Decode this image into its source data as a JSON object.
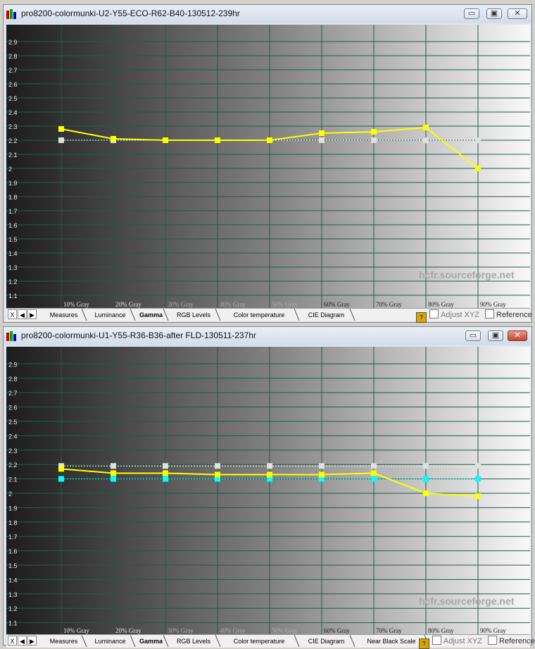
{
  "windows": [
    {
      "title": "pro8200-colormunki-U2-Y55-ECO-R62-B40-130512-239hr",
      "controls": {
        "minimize": "▭",
        "maximize": "▣",
        "close": "✕"
      },
      "tabs": {
        "close": "X",
        "prev": "◀",
        "next": "▶",
        "items": [
          "Measures",
          "Luminance",
          "Gamma",
          "RGB Levels",
          "Color temperature",
          "CIE Diagram"
        ],
        "active": "Gamma",
        "adjust_xyz": "Adjust XYZ",
        "reference": "Reference"
      },
      "chart": {
        "watermark": "hcfr.sourceforge.net",
        "x_labels": [
          "10% Gray",
          "20% Gray",
          "30% Gray",
          "40% Gray",
          "50% Gray",
          "60% Gray",
          "70% Gray",
          "80% Gray",
          "90% Gray"
        ],
        "y_ticks": [
          "2.9",
          "2.8",
          "2.7",
          "2.6",
          "2.5",
          "2.4",
          "2.3",
          "2.2",
          "2.1",
          "2",
          "1.9",
          "1.8",
          "1.7",
          "1.6",
          "1.5",
          "1.4",
          "1.3",
          "1.2",
          "1.1"
        ]
      }
    },
    {
      "title": "pro8200-colormunki-U1-Y55-R36-B36-after FLD-130511-237hr",
      "controls": {
        "minimize": "▭",
        "maximize": "▣",
        "close": "✕"
      },
      "tabs": {
        "close": "X",
        "prev": "◀",
        "next": "▶",
        "items": [
          "Measures",
          "Luminance",
          "Gamma",
          "RGB Levels",
          "Color temperature",
          "CIE Diagram",
          "Near Black Scale"
        ],
        "active": "Gamma",
        "adjust_xyz": "Adjust XYZ",
        "reference": "Reference"
      },
      "chart": {
        "watermark": "hcfr.sourceforge.net",
        "x_labels": [
          "10% Gray",
          "20% Gray",
          "30% Gray",
          "40% Gray",
          "50% Gray",
          "60% Gray",
          "70% Gray",
          "80% Gray",
          "90% Gray"
        ],
        "y_ticks": [
          "2.9",
          "2.8",
          "2.7",
          "2.6",
          "2.5",
          "2.4",
          "2.3",
          "2.2",
          "2.1",
          "2",
          "1.9",
          "1.8",
          "1.7",
          "1.6",
          "1.5",
          "1.4",
          "1.3",
          "1.2",
          "1.1"
        ]
      }
    }
  ],
  "chart_data": [
    {
      "type": "line",
      "x": [
        "10% Gray",
        "20% Gray",
        "30% Gray",
        "40% Gray",
        "50% Gray",
        "60% Gray",
        "70% Gray",
        "80% Gray",
        "90% Gray"
      ],
      "ylim": [
        1.0,
        3.0
      ],
      "grid": true,
      "series": [
        {
          "color": "#ffff00",
          "style": "solid",
          "values": [
            2.28,
            2.21,
            2.2,
            2.2,
            2.2,
            2.25,
            2.26,
            2.29,
            2.0
          ]
        },
        {
          "color": "#00ffff",
          "style": "dotted",
          "values": [
            2.2,
            2.2,
            2.2,
            2.2,
            2.2,
            2.2,
            2.2,
            2.2,
            2.2
          ]
        },
        {
          "color": "#ffffff",
          "style": "dotted",
          "values": [
            2.2,
            2.2,
            2.2,
            2.2,
            2.2,
            2.2,
            2.2,
            2.2,
            2.2
          ]
        }
      ]
    },
    {
      "type": "line",
      "x": [
        "10% Gray",
        "20% Gray",
        "30% Gray",
        "40% Gray",
        "50% Gray",
        "60% Gray",
        "70% Gray",
        "80% Gray",
        "90% Gray"
      ],
      "ylim": [
        1.0,
        3.0
      ],
      "grid": true,
      "series": [
        {
          "color": "#ffff00",
          "style": "solid",
          "values": [
            2.17,
            2.14,
            2.14,
            2.13,
            2.13,
            2.13,
            2.14,
            2.0,
            1.98
          ]
        },
        {
          "color": "#ffffff",
          "style": "dotted",
          "values": [
            2.19,
            2.19,
            2.19,
            2.19,
            2.19,
            2.19,
            2.19,
            2.19,
            2.19
          ]
        },
        {
          "color": "#00ffff",
          "style": "dotted",
          "values": [
            2.1,
            2.1,
            2.1,
            2.1,
            2.1,
            2.1,
            2.1,
            2.1,
            2.1
          ]
        }
      ]
    }
  ]
}
